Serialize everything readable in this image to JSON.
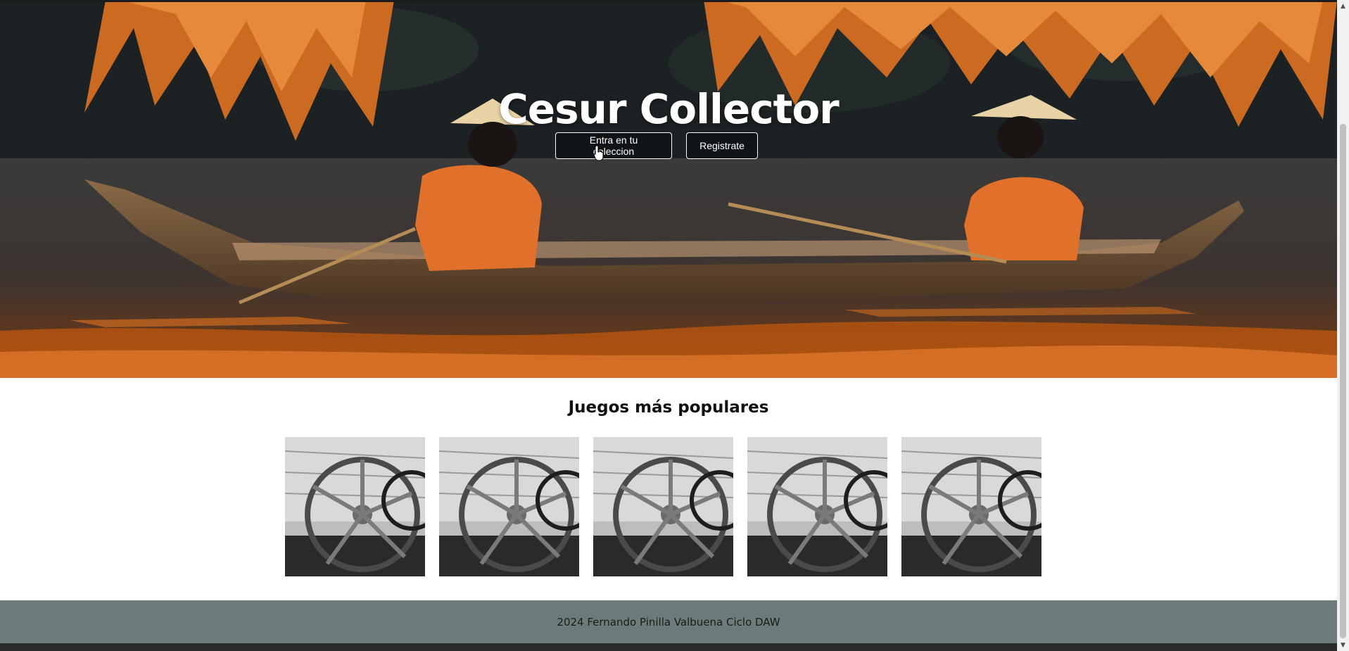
{
  "hero": {
    "title": "Cesur Collector",
    "login_button": "Entra en tu coleccion",
    "register_button": "Registrate"
  },
  "popular": {
    "title": "Juegos más populares",
    "games": [
      {
        "image": "wagon-wheel-photo"
      },
      {
        "image": "wagon-wheel-photo"
      },
      {
        "image": "wagon-wheel-photo"
      },
      {
        "image": "wagon-wheel-photo"
      },
      {
        "image": "wagon-wheel-photo"
      }
    ]
  },
  "footer": {
    "text": "2024 Fernando Pinilla Valbuena Ciclo DAW"
  },
  "colors": {
    "footer_bg": "#6b7b79",
    "button_bg": "#111417",
    "hero_orange": "#e0762a"
  },
  "icons": {
    "cursor": "hand-pointer-icon",
    "scroll_up": "chevron-up-icon",
    "scroll_down": "chevron-down-icon"
  }
}
